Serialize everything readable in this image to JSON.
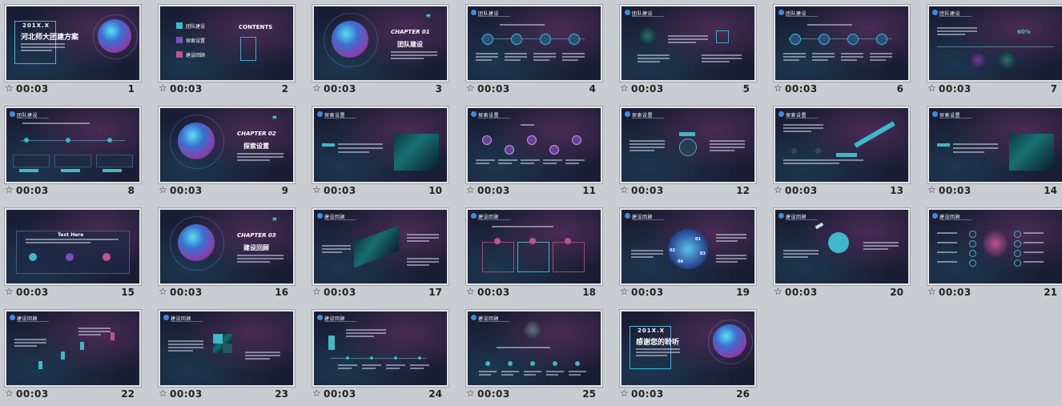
{
  "slides": [
    {
      "num": "1",
      "duration": "00:03",
      "kind": "cover",
      "year": "201X.X",
      "title": "河北师大团建方案"
    },
    {
      "num": "2",
      "duration": "00:03",
      "kind": "contents",
      "heading": "CONTENTS",
      "items": [
        "团队建设",
        "探索设置",
        "建设回顾"
      ]
    },
    {
      "num": "3",
      "duration": "00:03",
      "kind": "chapter",
      "chapter": "CHAPTER 01",
      "chapter_title": "团队建设"
    },
    {
      "num": "4",
      "duration": "00:03",
      "kind": "icons4",
      "section": "团队建设"
    },
    {
      "num": "5",
      "duration": "00:03",
      "kind": "photo-text",
      "section": "团队建设"
    },
    {
      "num": "6",
      "duration": "00:03",
      "kind": "icons4",
      "section": "团队建设"
    },
    {
      "num": "7",
      "duration": "00:03",
      "kind": "percent",
      "section": "团队建设",
      "percent": "60%"
    },
    {
      "num": "8",
      "duration": "00:03",
      "kind": "timeline3",
      "section": "团队建设"
    },
    {
      "num": "9",
      "duration": "00:03",
      "kind": "chapter",
      "chapter": "CHAPTER 02",
      "chapter_title": "探索设置"
    },
    {
      "num": "10",
      "duration": "00:03",
      "kind": "photo-right",
      "section": "探索设置"
    },
    {
      "num": "11",
      "duration": "00:03",
      "kind": "wave",
      "section": "探索设置"
    },
    {
      "num": "12",
      "duration": "00:03",
      "kind": "center-phone",
      "section": "探索设置"
    },
    {
      "num": "13",
      "duration": "00:03",
      "kind": "pencil",
      "section": "探索设置"
    },
    {
      "num": "14",
      "duration": "00:03",
      "kind": "photo-right",
      "section": "探索设置"
    },
    {
      "num": "15",
      "duration": "00:03",
      "kind": "panel3",
      "section": "探索设置",
      "panel_title": "Text Here"
    },
    {
      "num": "16",
      "duration": "00:03",
      "kind": "chapter",
      "chapter": "CHAPTER 03",
      "chapter_title": "建设回顾"
    },
    {
      "num": "17",
      "duration": "00:03",
      "kind": "iso",
      "section": "建设回顾"
    },
    {
      "num": "18",
      "duration": "00:03",
      "kind": "cards3",
      "section": "建设回顾"
    },
    {
      "num": "19",
      "duration": "00:03",
      "kind": "circle",
      "section": "建设回顾",
      "labels": [
        "01",
        "02",
        "03",
        "04"
      ]
    },
    {
      "num": "20",
      "duration": "00:03",
      "kind": "gear",
      "section": "建设回顾"
    },
    {
      "num": "21",
      "duration": "00:03",
      "kind": "bulb",
      "section": "建设回顾"
    },
    {
      "num": "22",
      "duration": "00:03",
      "kind": "figures",
      "section": "建设回顾"
    },
    {
      "num": "23",
      "duration": "00:03",
      "kind": "tiles",
      "section": "建设回顾"
    },
    {
      "num": "24",
      "duration": "00:03",
      "kind": "timeline-person",
      "section": "建设回顾"
    },
    {
      "num": "25",
      "duration": "00:03",
      "kind": "center-icon",
      "section": "建设回顾"
    },
    {
      "num": "26",
      "duration": "00:03",
      "kind": "end",
      "year": "201X.X",
      "title": "感谢您的聆听"
    }
  ],
  "icons": {
    "star": "star-icon"
  }
}
